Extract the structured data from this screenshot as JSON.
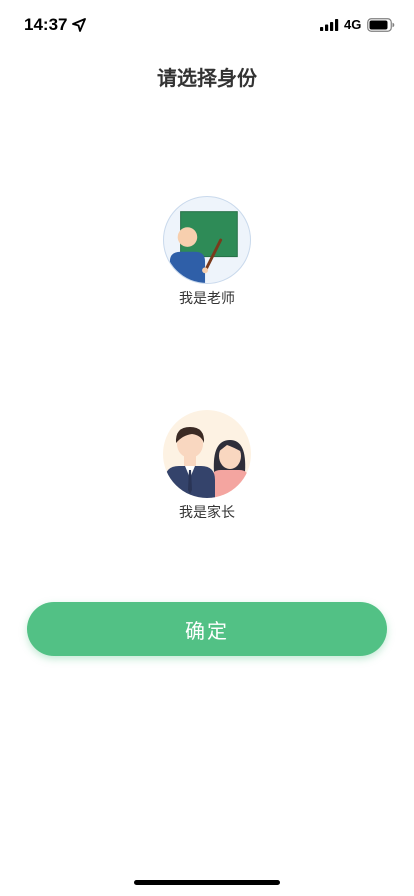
{
  "status_bar": {
    "time": "14:37",
    "network": "4G",
    "location_icon": "location-arrow-icon",
    "signal_icon": "cellular-signal-icon",
    "battery_icon": "battery-icon"
  },
  "page": {
    "title": "请选择身份"
  },
  "roles": [
    {
      "label": "我是老师",
      "icon": "teacher-avatar-icon"
    },
    {
      "label": "我是家长",
      "icon": "parent-avatar-icon"
    }
  ],
  "confirm_button": {
    "label": "确定",
    "color": "#52c185"
  }
}
